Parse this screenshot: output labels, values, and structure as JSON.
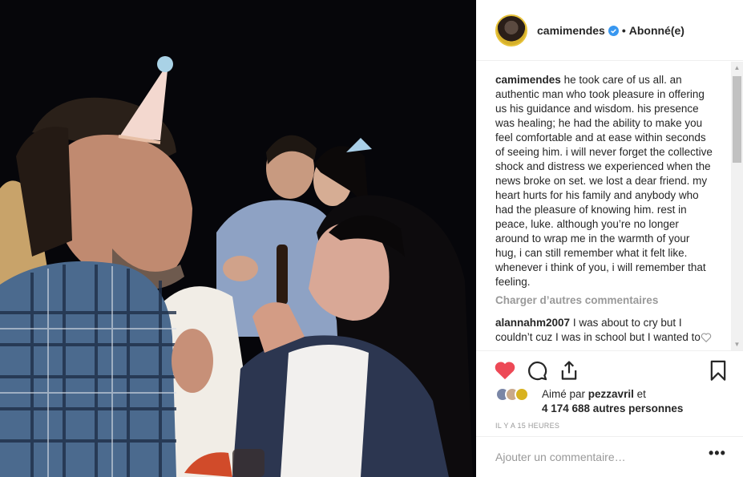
{
  "post": {
    "photo_alt": "photo",
    "username": "camimendes",
    "follow_label": "Abonné(e)",
    "caption_user": "camimendes",
    "caption_text": "he took care of us all. an authentic man who took pleasure in offering us his guidance and wisdom. his presence was healing; he had the ability to make you feel comfortable and at ease within seconds of seeing him. i will never forget the collective shock and distress we experienced when the news broke on set. we lost a dear friend. my heart hurts for his family and anybody who had the pleasure of knowing him. rest in peace, luke. although you’re no longer around to wrap me in the warmth of your hug, i can still remember what it felt like. whenever i think of you, i will remember that feeling.",
    "load_more_label": "Charger d’autres commentaires",
    "comments": [
      {
        "user": "alannahm2007",
        "text": "I was about to cry but I couldn’t cuz I was in school but I wanted to"
      }
    ],
    "liked_by_prefix": "Aimé par",
    "liked_by_user": "pezzavril",
    "liked_by_and": "et",
    "liked_by_rest": "4 174 688 autres personnes",
    "timestamp": "IL Y A 15 HEURES",
    "add_comment_placeholder": "Ajouter un commentaire…",
    "more_label": "•••"
  },
  "colors": {
    "like_red": "#ed4956",
    "verified_blue": "#3897f0",
    "muted": "#999999"
  },
  "icons": {
    "like": "heart-icon",
    "comment": "comment-icon",
    "share": "share-icon",
    "save": "bookmark-icon"
  }
}
